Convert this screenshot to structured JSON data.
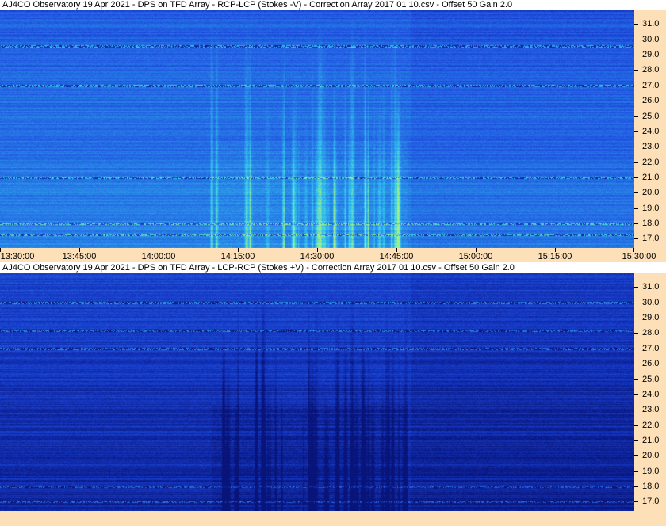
{
  "chart_data": [
    {
      "type": "heatmap",
      "title": "AJ4CO Observatory 19 Apr 2021  -  DPS on TFD Array  -  RCP-LCP (Stokes -V)  -  Correction Array 2017 01 10.csv  -  Offset 50  Gain 2.0",
      "xlabel": "",
      "ylabel": "",
      "x_ticks": [
        "13:30:00",
        "13:45:00",
        "14:00:00",
        "14:15:00",
        "14:30:00",
        "14:45:00",
        "15:00:00",
        "15:15:00",
        "15:30:00"
      ],
      "y_ticks": [
        "31.0",
        "30.0",
        "29.0",
        "28.0",
        "27.0",
        "26.0",
        "25.0",
        "24.0",
        "23.0",
        "22.0",
        "21.0",
        "20.0",
        "19.0",
        "18.0",
        "17.0"
      ],
      "xlim": [
        "13:30:00",
        "15:30:00"
      ],
      "ylim": [
        16.4,
        31.9
      ],
      "grid": false,
      "colormap": [
        "#0a1f9a",
        "#1f4fe0",
        "#2a8ae8",
        "#33c8f0",
        "#9ef08a"
      ],
      "burst_window": [
        "14:10:00",
        "14:47:00"
      ],
      "burst_sign": "positive",
      "interference_bands": [
        27.0,
        29.6,
        21.0,
        18.0,
        17.3
      ]
    },
    {
      "type": "heatmap",
      "title": "AJ4CO Observatory 19 Apr 2021  -  DPS on TFD Array  -  LCP-RCP (Stokes +V)  -  Correction Array 2017 01 10.csv  -  Offset 50  Gain 2.0",
      "xlabel": "",
      "ylabel": "",
      "x_ticks": [],
      "y_ticks": [
        "31.0",
        "30.0",
        "29.0",
        "28.0",
        "27.0",
        "26.0",
        "25.0",
        "24.0",
        "23.0",
        "22.0",
        "21.0",
        "20.0",
        "19.0",
        "18.0",
        "17.0"
      ],
      "xlim": [
        "13:30:00",
        "15:30:00"
      ],
      "ylim": [
        16.4,
        31.9
      ],
      "grid": false,
      "colormap": [
        "#081478",
        "#163ac8",
        "#2a6fe6",
        "#33b8f0",
        "#b8e860"
      ],
      "burst_window": [
        "14:10:00",
        "14:47:00"
      ],
      "burst_sign": "negative",
      "interference_bands": [
        27.0,
        30.0,
        28.2,
        18.0,
        17.0
      ]
    }
  ]
}
